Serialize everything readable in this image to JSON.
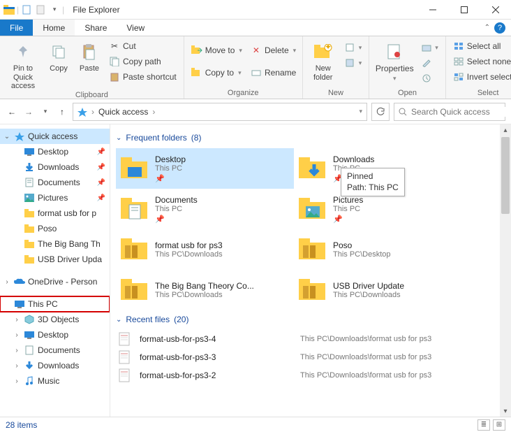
{
  "title": "File Explorer",
  "tabs": {
    "file": "File",
    "home": "Home",
    "share": "Share",
    "view": "View"
  },
  "ribbon": {
    "clipboard": {
      "label": "Clipboard",
      "pin": "Pin to Quick\naccess",
      "copy": "Copy",
      "paste": "Paste",
      "cut": "Cut",
      "copypath": "Copy path",
      "pasteshortcut": "Paste shortcut"
    },
    "organize": {
      "label": "Organize",
      "moveto": "Move to",
      "copyto": "Copy to",
      "delete": "Delete",
      "rename": "Rename"
    },
    "new": {
      "label": "New",
      "newfolder": "New\nfolder"
    },
    "open": {
      "label": "Open",
      "properties": "Properties"
    },
    "select": {
      "label": "Select",
      "selectall": "Select all",
      "selectnone": "Select none",
      "invert": "Invert selection"
    }
  },
  "address": {
    "root": "Quick access"
  },
  "search": {
    "placeholder": "Search Quick access"
  },
  "sidebar": {
    "quickaccess": "Quick access",
    "items": [
      {
        "label": "Desktop",
        "pinned": true
      },
      {
        "label": "Downloads",
        "pinned": true
      },
      {
        "label": "Documents",
        "pinned": true
      },
      {
        "label": "Pictures",
        "pinned": true
      },
      {
        "label": "format usb for p",
        "pinned": false
      },
      {
        "label": "Poso",
        "pinned": false
      },
      {
        "label": "The Big Bang Th",
        "pinned": false
      },
      {
        "label": "USB Driver Upda",
        "pinned": false
      }
    ],
    "onedrive": "OneDrive - Person",
    "thispc": "This PC",
    "pcitems": [
      {
        "label": "3D Objects"
      },
      {
        "label": "Desktop"
      },
      {
        "label": "Documents"
      },
      {
        "label": "Downloads"
      },
      {
        "label": "Music"
      }
    ]
  },
  "sections": {
    "frequent": {
      "title": "Frequent folders",
      "count": "(8)"
    },
    "recent": {
      "title": "Recent files",
      "count": "(20)"
    }
  },
  "folders": [
    {
      "name": "Desktop",
      "loc": "This PC",
      "pinned": true,
      "selected": true
    },
    {
      "name": "Downloads",
      "loc": "This PC",
      "pinned": true
    },
    {
      "name": "Documents",
      "loc": "This PC",
      "pinned": true
    },
    {
      "name": "Pictures",
      "loc": "This PC",
      "pinned": true
    },
    {
      "name": "format usb for ps3",
      "loc": "This PC\\Downloads"
    },
    {
      "name": "Poso",
      "loc": "This PC\\Desktop"
    },
    {
      "name": "The Big Bang Theory Co...",
      "loc": "This PC\\Downloads"
    },
    {
      "name": "USB Driver Update",
      "loc": "This PC\\Downloads"
    }
  ],
  "tooltip": {
    "line1": "Pinned",
    "line2": "Path: This PC"
  },
  "files": [
    {
      "name": "format-usb-for-ps3-4",
      "path": "This PC\\Downloads\\format usb for ps3"
    },
    {
      "name": "format-usb-for-ps3-3",
      "path": "This PC\\Downloads\\format usb for ps3"
    },
    {
      "name": "format-usb-for-ps3-2",
      "path": "This PC\\Downloads\\format usb for ps3"
    }
  ],
  "status": {
    "items": "28 items"
  }
}
